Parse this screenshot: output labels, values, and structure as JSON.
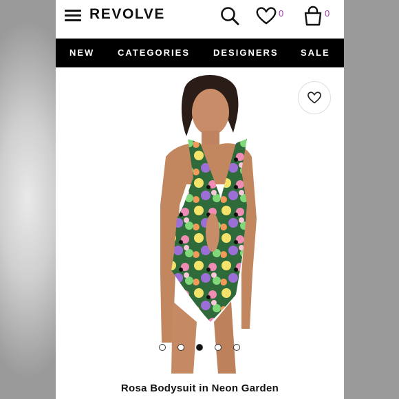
{
  "header": {
    "logo": "REVOLVE",
    "menu_icon": "hamburger-menu-icon",
    "search_icon": "search-icon",
    "wishlist_icon": "heart-icon",
    "wishlist_count": "0",
    "bag_icon": "shopping-bag-icon",
    "bag_count": "0",
    "count_color": "#a23aa8"
  },
  "nav": {
    "items": [
      "NEW",
      "CATEGORIES",
      "DESIGNERS",
      "SALE"
    ],
    "background": "#000000"
  },
  "product": {
    "title": "Rosa Bodysuit in Neon Garden",
    "price": "",
    "favorite_icon": "heart-outline-icon",
    "carousel": {
      "total": 5,
      "active": 3
    }
  }
}
